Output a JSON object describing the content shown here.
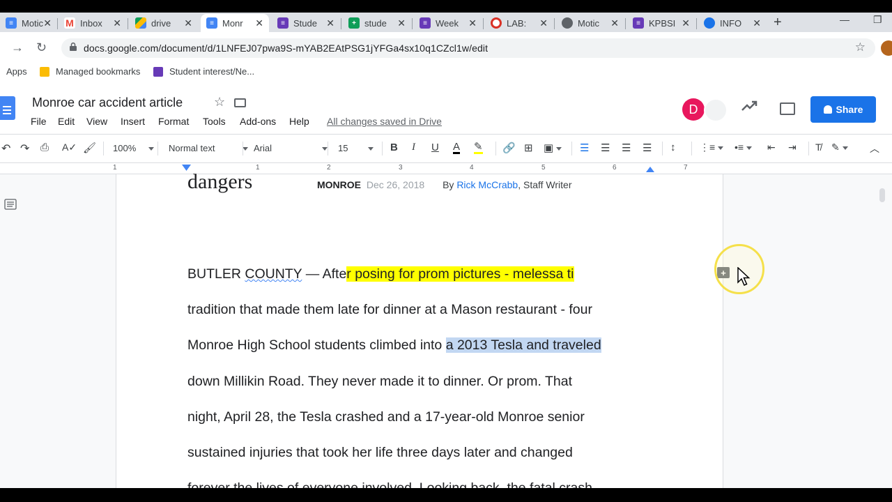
{
  "tabs": [
    {
      "label": "Motic",
      "color": "#4285f4"
    },
    {
      "label": "Inbox",
      "color": "#ea4335"
    },
    {
      "label": "drive",
      "color": "#fbbc04"
    },
    {
      "label": "Monr",
      "color": "#4285f4"
    },
    {
      "label": "Stude",
      "color": "#673ab7"
    },
    {
      "label": "stude",
      "color": "#0f9d58"
    },
    {
      "label": "Week",
      "color": "#673ab7"
    },
    {
      "label": "LAB:",
      "color": "#d93025"
    },
    {
      "label": "Motic",
      "color": "#5f6368"
    },
    {
      "label": "KPBSI",
      "color": "#673ab7"
    },
    {
      "label": "INFO",
      "color": "#1a73e8"
    }
  ],
  "address": {
    "url": "docs.google.com/document/d/1LNFEJ07pwa9S-mYAB2EAtPSG1jYFGa4sx10q1CZcl1w/edit"
  },
  "bookmarks": {
    "apps": "Apps",
    "managed": "Managed bookmarks",
    "student": "Student interest/Ne..."
  },
  "doc": {
    "title": "Monroe car accident article",
    "saved_status": "All changes saved in Drive",
    "share_label": "Share",
    "presence_initial": "D"
  },
  "menu": [
    "File",
    "Edit",
    "View",
    "Insert",
    "Format",
    "Tools",
    "Add-ons",
    "Help"
  ],
  "toolbar": {
    "zoom": "100%",
    "style": "Normal text",
    "font": "Arial",
    "size": "15"
  },
  "ruler": [
    "1",
    "1",
    "2",
    "3",
    "4",
    "5",
    "6",
    "7"
  ],
  "article": {
    "heading_fragment": "dangers",
    "location": "MONROE",
    "date": "Dec 26, 2018",
    "by": "By",
    "author": "Rick McCrabb",
    "role": ", Staff Writer",
    "line1_a": "BUTLER ",
    "line1_spell": "COUNTY",
    "line1_b": " — Afte",
    "line1_hl": "r posing for prom pictures - melessa ti",
    "line2": "tradition that made them late for dinner at a Mason restaurant - four",
    "line3_a": "Monroe High School students climbed into ",
    "line3_sel": "a 2013 Tesla and traveled",
    "line4": "down Millikin Road.  They never made it to dinner.  Or prom.  That",
    "line5": "night, April 28, the Tesla crashed and a 17-year-old Monroe senior",
    "line6": "sustained injuries that took her life three days later and changed",
    "line7": "forever the lives of everyone involved.  Looking back, the fatal crash"
  },
  "colors": {
    "highlight": "#ffff00",
    "selection": "#c2d7f2",
    "share": "#1a73e8",
    "author_link": "#1a73e8"
  }
}
